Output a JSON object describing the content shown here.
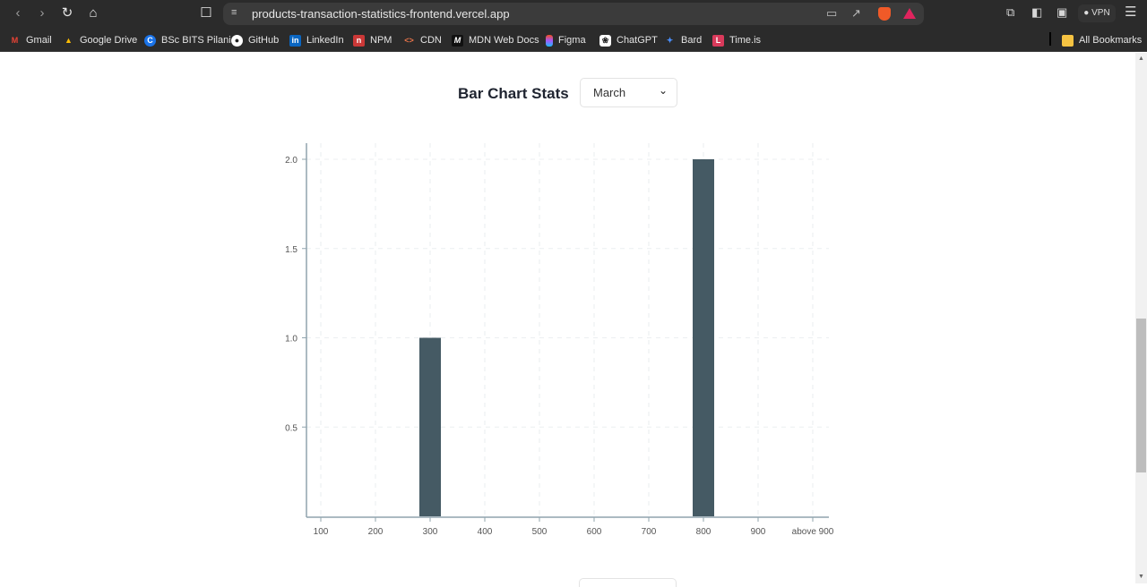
{
  "browser": {
    "url": "products-transaction-statistics-frontend.vercel.app",
    "vpn_label": "VPN",
    "bookmarks": [
      {
        "label": "Gmail",
        "icon": "gmail-icon",
        "color": "#ea4335"
      },
      {
        "label": "Google Drive",
        "icon": "google-drive-icon",
        "color": "#fbbc04"
      },
      {
        "label": "BSc BITS Pilani",
        "icon": "bits-icon",
        "color": "#1a73e8"
      },
      {
        "label": "GitHub",
        "icon": "github-icon",
        "color": "#ffffff"
      },
      {
        "label": "LinkedIn",
        "icon": "linkedin-icon",
        "color": "#0a66c2"
      },
      {
        "label": "NPM",
        "icon": "npm-icon",
        "color": "#cb3837"
      },
      {
        "label": "CDN",
        "icon": "code-icon",
        "color": "#e8744a"
      },
      {
        "label": "MDN Web Docs",
        "icon": "mdn-icon",
        "color": "#111111"
      },
      {
        "label": "Figma",
        "icon": "figma-icon",
        "color": "#f24e1e"
      },
      {
        "label": "ChatGPT",
        "icon": "chatgpt-icon",
        "color": "#ffffff"
      },
      {
        "label": "Bard",
        "icon": "bard-icon",
        "color": "#4a8df8"
      },
      {
        "label": "Time.is",
        "icon": "timeis-icon",
        "color": "#d93a5b"
      }
    ],
    "all_bookmarks_label": "All Bookmarks"
  },
  "page": {
    "title": "Bar Chart Stats",
    "month_select": {
      "value": "March"
    }
  },
  "chart_data": {
    "type": "bar",
    "title": "Bar Chart Stats",
    "xlabel": "",
    "ylabel": "",
    "categories": [
      "100",
      "200",
      "300",
      "400",
      "500",
      "600",
      "700",
      "800",
      "900",
      "above 900"
    ],
    "values": [
      0,
      0,
      1,
      0,
      0,
      0,
      0,
      2,
      0,
      0
    ],
    "ylim": [
      0,
      2.08
    ],
    "yticks": [
      0.5,
      1.0,
      1.5,
      2.0
    ],
    "ytick_labels": [
      "0.5",
      "1.0",
      "1.5",
      "2.0"
    ],
    "grid": true,
    "bar_color": "#455a64",
    "legend": "none"
  }
}
